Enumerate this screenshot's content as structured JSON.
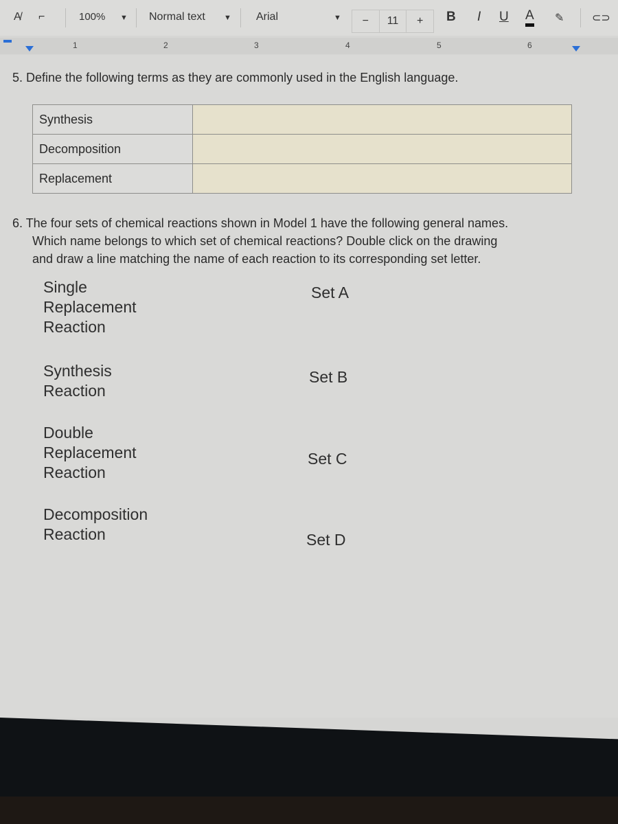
{
  "toolbar": {
    "zoom": "100%",
    "style": "Normal text",
    "font": "Arial",
    "font_size": "11",
    "decrease": "−",
    "increase": "+",
    "bold": "B",
    "italic": "I",
    "underline": "U",
    "text_color": "A"
  },
  "ruler": {
    "marks": [
      "1",
      "2",
      "3",
      "4",
      "5",
      "6"
    ]
  },
  "question5": {
    "text": "5.  Define the following terms as they are commonly used in the English language.",
    "rows": [
      {
        "term": "Synthesis",
        "definition": ""
      },
      {
        "term": "Decomposition",
        "definition": ""
      },
      {
        "term": "Replacement",
        "definition": ""
      }
    ]
  },
  "question6": {
    "line1": "6.  The four sets of chemical reactions shown in Model 1 have the following general names.",
    "line2": "Which name belongs to which set of chemical reactions? Double click on the drawing",
    "line3": "and draw a line matching the name of each reaction to its corresponding set letter."
  },
  "drawing": {
    "names": [
      [
        "Single",
        "Replacement",
        "Reaction"
      ],
      [
        "Synthesis",
        "Reaction"
      ],
      [
        "Double",
        "Replacement",
        "Reaction"
      ],
      [
        "Decomposition",
        "Reaction"
      ]
    ],
    "sets": [
      "Set A",
      "Set B",
      "Set C",
      "Set D"
    ]
  },
  "colors": {
    "definition_cell": "#e6e1cc",
    "ruler_marker": "#2b6fd6"
  }
}
